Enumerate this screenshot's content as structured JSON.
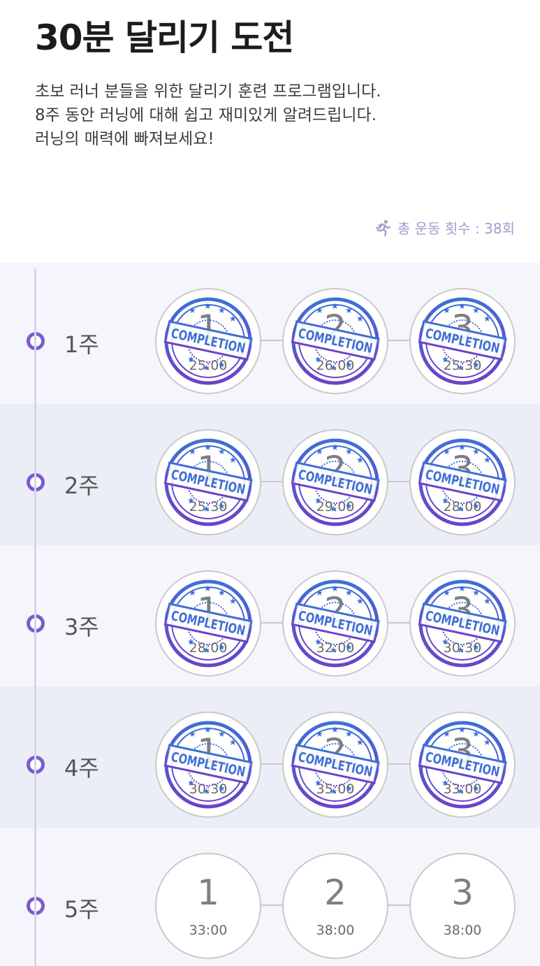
{
  "header": {
    "title": "30분 달리기 도전",
    "description": [
      "초보 러너 분들을 위한 달리기 훈련 프로그램입니다.",
      "8주 동안 러닝에 대해 쉽고 재미있게 알려드립니다.",
      "러닝의 매력에 빠져보세요!"
    ],
    "total_workouts": "총 운동 횟수 : 38회"
  },
  "stamp_text": "COMPLETION",
  "colors": {
    "accent": "#7a5ccf",
    "stamp_blue": "#3f6fd6",
    "stamp_purple": "#6a43c9",
    "muted": "#a29ccf"
  },
  "weeks": [
    {
      "label": "1주",
      "sessions": [
        {
          "num": "1",
          "time": "25:00",
          "completed": true
        },
        {
          "num": "2",
          "time": "26:00",
          "completed": true
        },
        {
          "num": "3",
          "time": "25:30",
          "completed": true
        }
      ]
    },
    {
      "label": "2주",
      "sessions": [
        {
          "num": "1",
          "time": "25:30",
          "completed": true
        },
        {
          "num": "2",
          "time": "29:00",
          "completed": true
        },
        {
          "num": "3",
          "time": "28:00",
          "completed": true
        }
      ]
    },
    {
      "label": "3주",
      "sessions": [
        {
          "num": "1",
          "time": "28:00",
          "completed": true
        },
        {
          "num": "2",
          "time": "32:00",
          "completed": true
        },
        {
          "num": "3",
          "time": "30:30",
          "completed": true
        }
      ]
    },
    {
      "label": "4주",
      "sessions": [
        {
          "num": "1",
          "time": "30:30",
          "completed": true
        },
        {
          "num": "2",
          "time": "35:00",
          "completed": true
        },
        {
          "num": "3",
          "time": "33:00",
          "completed": true
        }
      ]
    },
    {
      "label": "5주",
      "sessions": [
        {
          "num": "1",
          "time": "33:00",
          "completed": false
        },
        {
          "num": "2",
          "time": "38:00",
          "completed": false
        },
        {
          "num": "3",
          "time": "38:00",
          "completed": false
        }
      ]
    }
  ]
}
